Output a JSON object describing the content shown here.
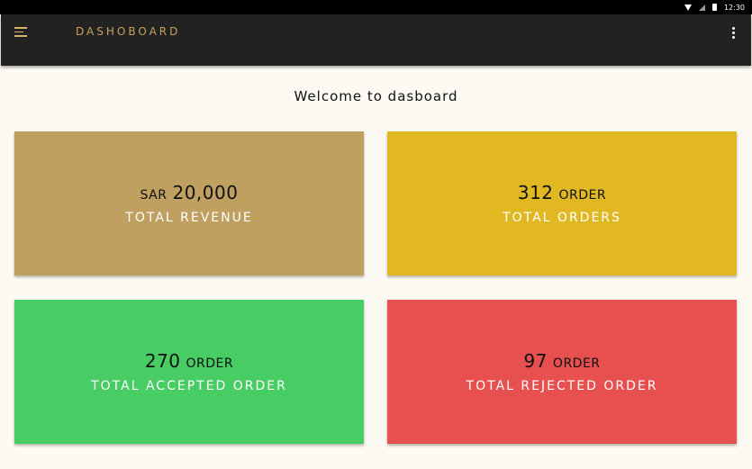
{
  "status_bar": {
    "time": "12:30"
  },
  "app_bar": {
    "title": "DASHOBOARD"
  },
  "welcome": "Welcome to dasboard",
  "cards": {
    "revenue": {
      "prefix": "SAR",
      "value": "20,000",
      "suffix": "",
      "label": "TOTAL REVENUE",
      "color": "#c0a060"
    },
    "orders": {
      "prefix": "",
      "value": "312",
      "suffix": "ORDER",
      "label": "TOTAL ORDERS",
      "color": "#e2b822"
    },
    "accepted": {
      "prefix": "",
      "value": "270",
      "suffix": "ORDER",
      "label": "TOTAL ACCEPTED ORDER",
      "color": "#48cc64"
    },
    "rejected": {
      "prefix": "",
      "value": "97",
      "suffix": "ORDER",
      "label": "TOTAL REJECTED ORDER",
      "color": "#e85050"
    }
  },
  "colors": {
    "accent": "#c9a25a",
    "app_bar": "#222222",
    "background": "#fdfaf3"
  }
}
